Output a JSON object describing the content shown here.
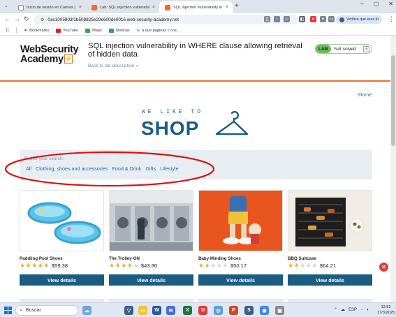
{
  "browser": {
    "tabs": [
      {
        "title": "Inicio de sesión en Canvas | Inst",
        "active": false
      },
      {
        "title": "Lab: SQL injection vulnerability",
        "active": false
      },
      {
        "title": "SQL injection vulnerability in W",
        "active": true
      }
    ],
    "url": "0ac1005803f1b509825e29e600de0016.web-security-academy.net",
    "profile_label": "Verifica que eres tú",
    "bookmarks": [
      {
        "label": "Bookmarks",
        "icon": "star-icon"
      },
      {
        "label": "YouTube",
        "icon": "youtube-icon"
      },
      {
        "label": "Maps",
        "icon": "maps-icon"
      },
      {
        "label": "Noticias",
        "icon": "news-icon"
      },
      {
        "label": "a que paginas c cos...",
        "icon": "google-icon"
      }
    ]
  },
  "header": {
    "logo_line1": "WebSecurity",
    "logo_line2": "Academy",
    "logo_mark": "⚡",
    "lab_title": "SQL injection vulnerability in WHERE clause allowing retrieval of hidden data",
    "back_link": "Back to lab description",
    "back_chevron": "»",
    "lab_badge": "LAB",
    "lab_status": "Not solved"
  },
  "nav": {
    "home": "Home"
  },
  "shop": {
    "tagline": "WE LIKE TO",
    "word": "SHOP"
  },
  "filter": {
    "label": "Refine your search:",
    "categories": [
      "All",
      "Clothing, shoes and accessories",
      "Food & Drink",
      "Gifts",
      "Lifestyle"
    ]
  },
  "products": [
    {
      "name": "Paddling Pool Shoes",
      "stars": 5,
      "price": "$59.38",
      "button": "View details"
    },
    {
      "name": "The Trolley-ON",
      "stars": 4,
      "price": "$43.30",
      "button": "View details"
    },
    {
      "name": "Baby Minding Shoes",
      "stars": 2,
      "price": "$50.17",
      "button": "View details"
    },
    {
      "name": "BBQ Suitcase",
      "stars": 2,
      "price": "$64.21",
      "button": "View details"
    }
  ],
  "taskbar": {
    "search_placeholder": "Buscar",
    "language": "ESP",
    "time": "12:53",
    "date": "17/3/2025"
  },
  "colors": {
    "brand_orange": "#f26a2b",
    "shop_blue": "#1b5c82",
    "link_blue": "#1b6fa8",
    "annotation_red": "#e01010",
    "star": "#f5a623"
  }
}
